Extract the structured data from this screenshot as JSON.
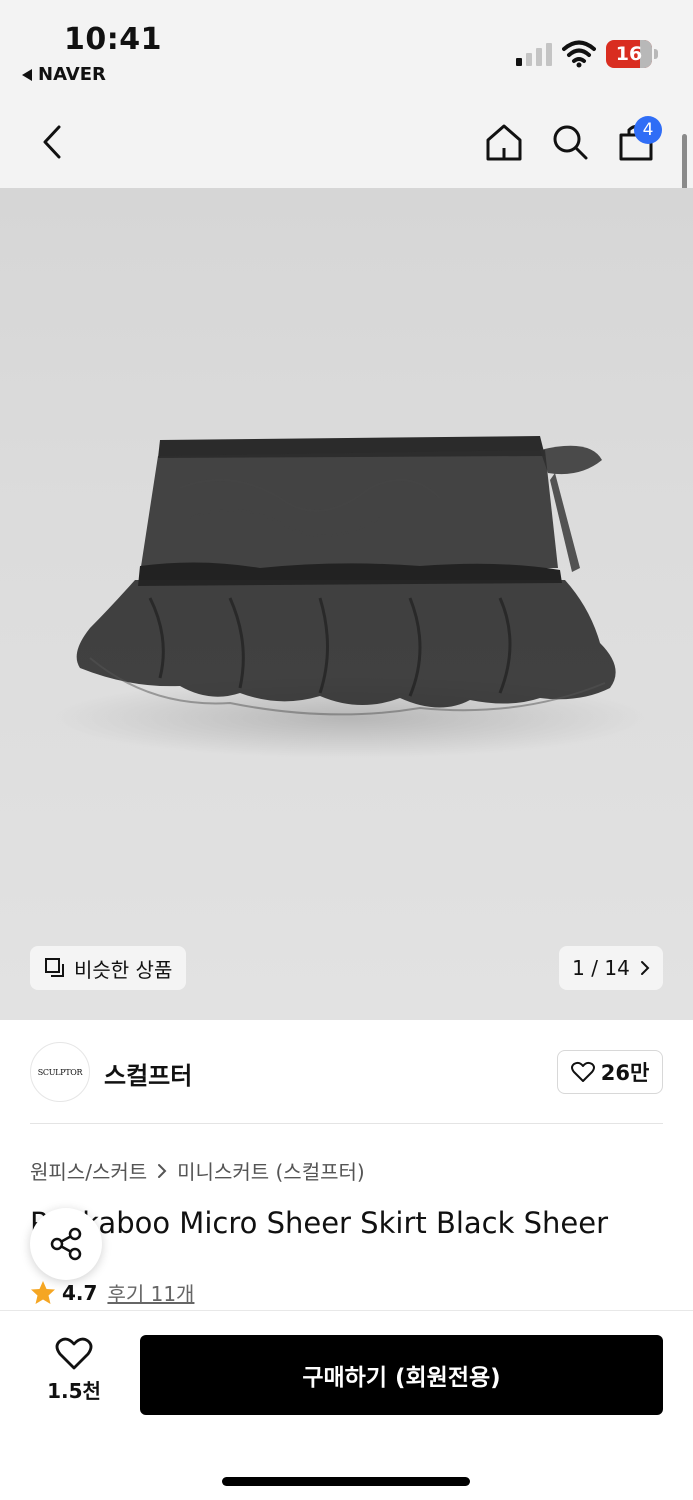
{
  "status": {
    "time": "10:41",
    "back_app": "NAVER",
    "battery": "16"
  },
  "nav": {
    "cart_count": "4",
    "icons": [
      "chevron-left-icon",
      "home-icon",
      "search-icon",
      "shopping-bag-icon"
    ]
  },
  "gallery": {
    "similar_label": "비슷한 상품",
    "counter": "1 / 14"
  },
  "shop": {
    "logo_text": "SCULPTOR",
    "name": "스컬프터",
    "likes": "26만"
  },
  "product": {
    "category": "원피스/스커트",
    "subcategory": "미니스커트 (스컬프터)",
    "title": "Peekaboo Micro Sheer Skirt Black Sheer",
    "rating": "4.7",
    "reviews": "후기 11개"
  },
  "bottom": {
    "wish_count": "1.5천",
    "buy_label": "구매하기 (회원전용)"
  },
  "colors": {
    "accent": "#2f6df6",
    "battery_low": "#d92d20",
    "star": "#f5a623",
    "buy_button": "#000000"
  }
}
